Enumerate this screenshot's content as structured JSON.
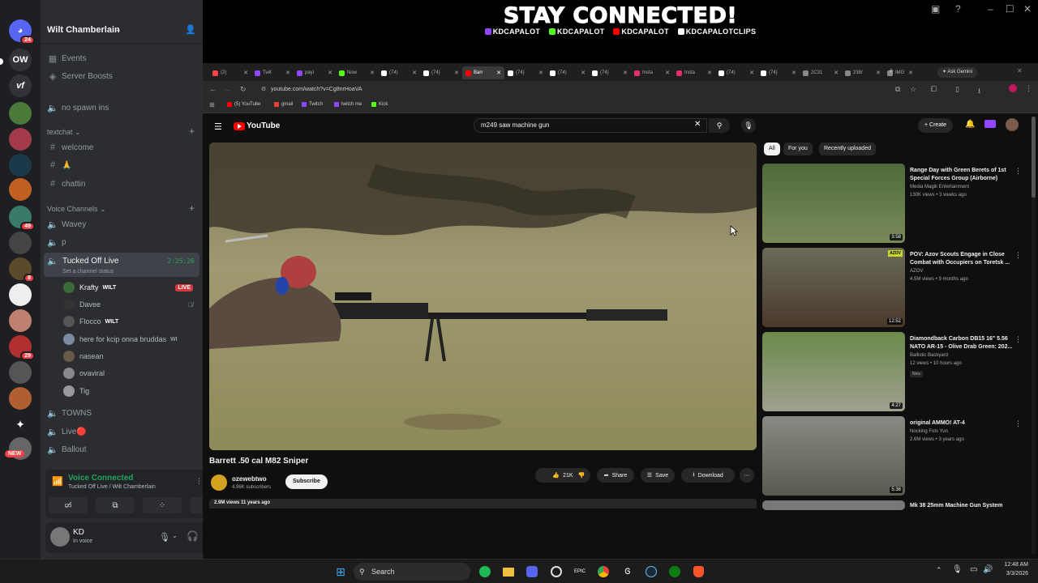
{
  "overlay": {
    "title": "STAY CONNECTED!",
    "handles": [
      "KDCAPALOT",
      "KDCAPALOT",
      "KDCAPALOT",
      "KDCAPALOTCLIPS"
    ]
  },
  "discord": {
    "rail": {
      "badge_top": "24",
      "ow_label": "OW",
      "vf_label": "vf",
      "badge_49": "49",
      "badge_8": "8",
      "badge_29": "29",
      "new_label": "NEW"
    },
    "guild_name": "Wilt Chamberlain",
    "top_items": [
      "Events",
      "Server Boosts",
      "no spawn ins"
    ],
    "textchat_category": "textchat",
    "text_channels": [
      "welcome",
      "🙏",
      "chattin"
    ],
    "voice_category": "Voice Channels",
    "voice_channels_a": [
      "Wavey",
      "p"
    ],
    "active_channel": {
      "name": "Tucked Off Live",
      "timer": "2:25:26",
      "status_placeholder": "Set a channel status"
    },
    "voice_users": [
      {
        "name": "Krafty",
        "tag": "WILT",
        "live": "LIVE"
      },
      {
        "name": "Davee"
      },
      {
        "name": "Flocco",
        "tag": "WILT"
      },
      {
        "name": "here for kcip onna bruddas",
        "tag": "WI"
      },
      {
        "name": "nasean"
      },
      {
        "name": "ovaviral"
      },
      {
        "name": "Tig"
      }
    ],
    "voice_channels_b": [
      "TOWNS",
      "Live🔴",
      "Ballout"
    ],
    "voice_status": {
      "title": "Voice Connected",
      "subtitle": "Tucked Off Live / Wilt Chamberlain"
    },
    "user": {
      "name": "KD",
      "status": "In voice"
    }
  },
  "browser": {
    "tabs": [
      "(2)",
      "Twit",
      "payl",
      "Now",
      "(74)",
      "(74)",
      "Barr",
      "(74)",
      "(74)",
      "(74)",
      "Insta",
      "Insta",
      "(74)",
      "(74)",
      "2C31",
      "238/",
      "IMG"
    ],
    "ask_gemini": "Ask Gemini",
    "url": "youtube.com/watch?v=Cg8nrHoaVA",
    "bookmarks": [
      "(5) YouTube",
      "gmail",
      "Twitch",
      "twitch me",
      "Kick"
    ],
    "youtube": {
      "logo": "YouTube",
      "search_query": "m249 saw machine gun",
      "create_label": "Create",
      "video_title": "Barrett .50 cal M82 Sniper",
      "channel_name": "ozewebtwo",
      "subscribers": "4.96K subscribers",
      "subscribe_label": "Subscribe",
      "likes": "21K",
      "share_label": "Share",
      "save_label": "Save",
      "download_label": "Download",
      "views_line": "2.9M views  11 years ago",
      "chips": [
        "All",
        "For you",
        "Recently uploaded"
      ],
      "recommendations": [
        {
          "title": "Range Day with Green Berets of 1st Special Forces Group (Airborne)",
          "channel": "Media Magik Entertainment",
          "meta": "130K views • 3 weeks ago",
          "duration": "3:58"
        },
        {
          "title": "POV: Azov Scouts Engage in Close Combat with Occupiers on Toretsk ...",
          "channel": "AZOV",
          "meta": "4.5M views • 9 months ago",
          "duration": "12:52",
          "badge": "AZOV"
        },
        {
          "title": "Diamondback Carbon DB15 16\" 5.56 NATO AR-15 - Olive Drab Green: 202...",
          "channel": "Ballistic Backyard",
          "meta": "12 views • 10 hours ago",
          "duration": "4:27",
          "badge": "New"
        },
        {
          "title": "original AMMO! AT-4",
          "channel": "Nocking Fots Yun",
          "meta": "2.6M views • 3 years ago",
          "duration": "5:36"
        },
        {
          "title": "Mk 38 25mm Machine Gun System",
          "channel": "",
          "meta": "",
          "duration": ""
        }
      ]
    }
  },
  "taskbar": {
    "search_label": "Search",
    "time": "12:48 AM",
    "date": "3/3/2026"
  },
  "colors": {
    "discord_bg": "#2b2d31",
    "rail_bg": "#1e1f22",
    "voice_green": "#23a55a",
    "live_red": "#da373c",
    "youtube_red": "#ff0000"
  }
}
